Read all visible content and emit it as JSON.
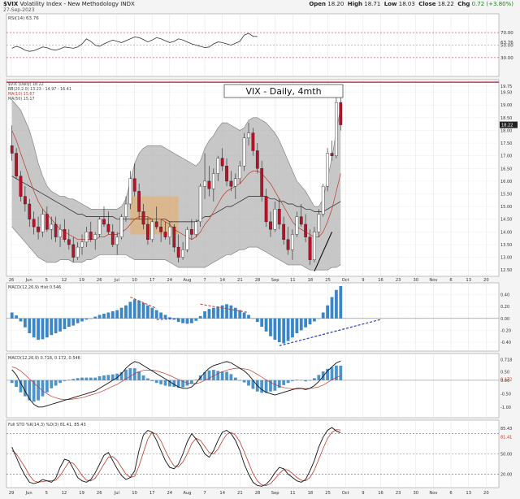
{
  "header": {
    "symbol": "$VIX",
    "name": "Volatility Index - New Methodology INDX",
    "date": "27-Sep-2023",
    "open_label": "Open",
    "open": "18.20",
    "high_label": "High",
    "high": "18.71",
    "low_label": "Low",
    "low": "18.03",
    "close_label": "Close",
    "close": "18.22",
    "chg_label": "Chg",
    "chg": "0.72 (+3.80%)"
  },
  "annotation": {
    "title": "VIX - Daily, 4mth"
  },
  "colors": {
    "up": "#ffffff",
    "down": "#b8122a",
    "band_fill": "#b4b4b4",
    "hist": "#3a87c7",
    "price_line": "#b8122a"
  },
  "chart_data": [
    {
      "panel": "rsi",
      "type": "line",
      "legend": "RSI(14) 63.76",
      "values": [
        45,
        48,
        46,
        42,
        40,
        41,
        44,
        47,
        46,
        43,
        42,
        44,
        47,
        46,
        45,
        47,
        52,
        60,
        56,
        50,
        48,
        52,
        55,
        58,
        56,
        54,
        57,
        60,
        63,
        62,
        59,
        55,
        58,
        62,
        60,
        57,
        54,
        56,
        60,
        58,
        55,
        52,
        50,
        48,
        46,
        47,
        52,
        55,
        54,
        52,
        50,
        53,
        56,
        66,
        69,
        64,
        63.8
      ],
      "ylim": [
        0,
        100
      ],
      "guides": [
        30,
        50,
        70
      ],
      "tick_labels": [
        "70.00",
        "63.76",
        "50.00",
        "30.00"
      ]
    },
    {
      "panel": "price",
      "type": "candlestick",
      "legend": [
        "$VIX (Daily) 18.22",
        "BB(20,2.0) 13.23 - 14.97 - 16.41",
        "MA(10) 15.67",
        "MA(50) 15.17"
      ],
      "x_labels": [
        "26",
        "Jun",
        "5",
        "12",
        "19",
        "26",
        "Jul",
        "10",
        "17",
        "24",
        "Aug",
        "7",
        "14",
        "21",
        "28",
        "Sep",
        "11",
        "18",
        "25",
        "Oct",
        "9",
        "16",
        "23",
        "30",
        "Nov",
        "6",
        "13",
        "20"
      ],
      "ylim": [
        12.25,
        20.0
      ],
      "y_ticks": [
        12.5,
        13.0,
        13.5,
        14.0,
        14.5,
        15.0,
        15.5,
        16.0,
        16.5,
        17.0,
        17.5,
        18.0,
        18.5,
        19.0,
        19.5,
        19.75
      ],
      "close_label": "18.22",
      "ohlc": [
        [
          17.4,
          18.2,
          16.8,
          17.1
        ],
        [
          17.1,
          17.3,
          16.1,
          16.2
        ],
        [
          16.2,
          16.4,
          15.2,
          15.4
        ],
        [
          15.4,
          15.8,
          14.8,
          15.1
        ],
        [
          15.1,
          15.3,
          14.2,
          14.5
        ],
        [
          14.5,
          14.8,
          13.9,
          14.2
        ],
        [
          14.2,
          14.6,
          13.7,
          14.0
        ],
        [
          14.0,
          14.9,
          13.8,
          14.7
        ],
        [
          14.7,
          15.0,
          14.0,
          14.1
        ],
        [
          14.1,
          14.6,
          13.7,
          14.3
        ],
        [
          14.3,
          14.6,
          13.6,
          13.8
        ],
        [
          13.8,
          14.3,
          13.4,
          14.1
        ],
        [
          14.1,
          14.5,
          13.6,
          13.7
        ],
        [
          13.7,
          14.1,
          13.3,
          13.5
        ],
        [
          13.5,
          13.8,
          12.8,
          13.0
        ],
        [
          13.0,
          13.6,
          12.9,
          13.4
        ],
        [
          13.4,
          13.9,
          13.1,
          13.6
        ],
        [
          13.6,
          14.2,
          13.4,
          14.0
        ],
        [
          14.0,
          14.4,
          13.6,
          13.7
        ],
        [
          13.7,
          14.0,
          13.3,
          13.9
        ],
        [
          13.9,
          14.6,
          13.8,
          14.5
        ],
        [
          14.5,
          15.0,
          14.2,
          14.3
        ],
        [
          14.3,
          14.8,
          13.9,
          14.0
        ],
        [
          14.0,
          14.3,
          13.4,
          13.5
        ],
        [
          13.5,
          14.0,
          13.1,
          13.8
        ],
        [
          13.8,
          14.7,
          13.7,
          14.6
        ],
        [
          14.6,
          15.4,
          14.4,
          15.1
        ],
        [
          15.1,
          16.4,
          14.9,
          16.1
        ],
        [
          16.1,
          16.7,
          15.4,
          15.6
        ],
        [
          15.6,
          15.9,
          14.5,
          14.8
        ],
        [
          14.8,
          15.1,
          14.1,
          14.3
        ],
        [
          14.3,
          14.6,
          13.5,
          13.7
        ],
        [
          13.7,
          14.5,
          13.6,
          14.4
        ],
        [
          14.4,
          15.0,
          14.1,
          14.2
        ],
        [
          14.2,
          14.5,
          13.6,
          14.0
        ],
        [
          14.0,
          14.4,
          13.7,
          13.8
        ],
        [
          13.8,
          14.4,
          13.5,
          14.2
        ],
        [
          14.2,
          14.3,
          13.2,
          13.4
        ],
        [
          13.4,
          13.9,
          12.8,
          13.0
        ],
        [
          13.0,
          13.6,
          12.9,
          13.3
        ],
        [
          13.3,
          14.2,
          13.2,
          14.1
        ],
        [
          14.1,
          14.5,
          13.7,
          13.9
        ],
        [
          13.9,
          14.5,
          13.8,
          14.4
        ],
        [
          14.4,
          15.9,
          14.2,
          15.8
        ],
        [
          15.8,
          17.1,
          15.3,
          16.0
        ],
        [
          16.0,
          16.6,
          15.4,
          15.7
        ],
        [
          15.7,
          16.5,
          15.2,
          16.3
        ],
        [
          16.3,
          17.0,
          16.0,
          16.9
        ],
        [
          16.9,
          17.3,
          16.4,
          16.6
        ],
        [
          16.6,
          16.9,
          15.8,
          16.0
        ],
        [
          16.0,
          16.4,
          15.6,
          15.8
        ],
        [
          15.8,
          16.3,
          15.3,
          16.1
        ],
        [
          16.1,
          16.8,
          15.9,
          16.6
        ],
        [
          16.6,
          17.9,
          16.4,
          17.7
        ],
        [
          17.7,
          18.3,
          17.4,
          17.9
        ],
        [
          17.9,
          18.1,
          17.0,
          17.2
        ],
        [
          17.2,
          17.5,
          16.3,
          16.5
        ],
        [
          16.5,
          16.8,
          15.2,
          15.4
        ],
        [
          15.4,
          15.7,
          14.2,
          14.4
        ],
        [
          14.4,
          14.8,
          13.8,
          14.1
        ],
        [
          14.1,
          15.2,
          14.0,
          14.9
        ],
        [
          14.9,
          15.3,
          14.1,
          14.3
        ],
        [
          14.3,
          14.6,
          13.5,
          13.7
        ],
        [
          13.7,
          14.2,
          13.1,
          13.3
        ],
        [
          13.3,
          14.1,
          12.9,
          13.9
        ],
        [
          13.9,
          14.8,
          13.8,
          14.6
        ],
        [
          14.6,
          15.1,
          14.2,
          14.3
        ],
        [
          14.3,
          14.7,
          13.6,
          13.8
        ],
        [
          13.8,
          14.1,
          12.7,
          12.9
        ],
        [
          12.9,
          14.2,
          12.8,
          14.0
        ],
        [
          14.0,
          14.9,
          13.8,
          14.7
        ],
        [
          14.7,
          15.9,
          14.6,
          15.8
        ],
        [
          15.8,
          17.3,
          15.6,
          17.1
        ],
        [
          17.1,
          17.6,
          16.8,
          17.0
        ],
        [
          17.0,
          19.4,
          16.9,
          19.1
        ],
        [
          19.1,
          19.6,
          18.0,
          18.22
        ]
      ],
      "bb_upper": [
        19.2,
        19.0,
        18.8,
        18.4,
        18.0,
        17.4,
        16.7,
        16.2,
        15.8,
        15.6,
        15.5,
        15.4,
        15.4,
        15.3,
        15.3,
        15.2,
        15.1,
        15.0,
        14.9,
        14.9,
        14.9,
        14.9,
        14.9,
        14.9,
        14.9,
        15.0,
        15.3,
        16.0,
        16.7,
        17.1,
        17.3,
        17.4,
        17.4,
        17.4,
        17.4,
        17.3,
        17.2,
        17.1,
        17.0,
        16.9,
        16.8,
        16.7,
        16.6,
        16.8,
        17.3,
        17.6,
        17.8,
        18.1,
        18.3,
        18.3,
        18.2,
        18.1,
        18.0,
        18.1,
        18.4,
        18.5,
        18.5,
        18.4,
        18.3,
        18.1,
        17.9,
        17.6,
        17.2,
        16.8,
        16.4,
        16.0,
        15.8,
        15.6,
        15.3,
        15.0,
        15.0,
        15.3,
        16.1,
        16.9,
        18.0,
        18.9
      ],
      "bb_lower": [
        14.2,
        14.0,
        13.8,
        13.6,
        13.4,
        13.2,
        13.0,
        12.9,
        12.8,
        12.8,
        12.8,
        12.9,
        12.9,
        12.9,
        12.8,
        12.8,
        12.8,
        12.9,
        12.9,
        13.0,
        13.1,
        13.1,
        13.1,
        13.1,
        13.1,
        13.1,
        13.1,
        13.0,
        12.9,
        12.9,
        12.9,
        12.9,
        12.9,
        12.9,
        12.9,
        12.9,
        12.8,
        12.7,
        12.6,
        12.6,
        12.6,
        12.6,
        12.6,
        12.6,
        12.6,
        12.7,
        12.8,
        12.9,
        13.0,
        13.1,
        13.1,
        13.2,
        13.3,
        13.3,
        13.4,
        13.4,
        13.4,
        13.3,
        13.2,
        13.1,
        13.0,
        12.9,
        12.8,
        12.7,
        12.7,
        12.7,
        12.7,
        12.6,
        12.5,
        12.5,
        12.5,
        12.5,
        12.5,
        12.6,
        12.6,
        12.7
      ],
      "ma10": [
        18.0,
        17.6,
        17.1,
        16.6,
        16.1,
        15.6,
        15.2,
        14.9,
        14.7,
        14.5,
        14.3,
        14.1,
        14.0,
        13.9,
        13.8,
        13.7,
        13.7,
        13.7,
        13.7,
        13.7,
        13.8,
        13.8,
        13.9,
        13.9,
        13.9,
        14.0,
        14.1,
        14.3,
        14.5,
        14.6,
        14.6,
        14.6,
        14.5,
        14.5,
        14.5,
        14.4,
        14.3,
        14.1,
        14.0,
        13.9,
        13.8,
        13.7,
        13.8,
        14.0,
        14.3,
        14.5,
        14.8,
        15.1,
        15.4,
        15.6,
        15.7,
        15.8,
        15.9,
        16.1,
        16.3,
        16.4,
        16.4,
        16.3,
        16.1,
        15.9,
        15.6,
        15.3,
        15.0,
        14.7,
        14.4,
        14.2,
        14.1,
        14.0,
        13.9,
        13.8,
        13.8,
        14.0,
        14.4,
        14.9,
        15.6,
        16.3
      ],
      "ma50": [
        16.2,
        16.1,
        16.0,
        15.9,
        15.8,
        15.7,
        15.6,
        15.5,
        15.4,
        15.3,
        15.2,
        15.1,
        15.0,
        14.9,
        14.8,
        14.7,
        14.7,
        14.6,
        14.6,
        14.6,
        14.6,
        14.6,
        14.6,
        14.6,
        14.5,
        14.5,
        14.5,
        14.5,
        14.5,
        14.5,
        14.5,
        14.5,
        14.5,
        14.5,
        14.5,
        14.5,
        14.4,
        14.4,
        14.4,
        14.4,
        14.4,
        14.4,
        14.4,
        14.5,
        14.6,
        14.6,
        14.7,
        14.8,
        14.9,
        15.0,
        15.0,
        15.1,
        15.2,
        15.3,
        15.4,
        15.4,
        15.4,
        15.4,
        15.4,
        15.3,
        15.3,
        15.2,
        15.2,
        15.1,
        15.1,
        15.0,
        15.0,
        14.9,
        14.9,
        14.8,
        14.8,
        14.8,
        14.9,
        15.0,
        15.1,
        15.2
      ]
    },
    {
      "panel": "macd_hist",
      "type": "bar",
      "legend": "MACD(12,26,9) Hist 0.546",
      "tick_labels": [
        "0.40",
        "0.20",
        "0.00",
        "-0.20",
        "-0.40"
      ],
      "ylim": [
        -0.55,
        0.6
      ],
      "values": [
        0.1,
        0.05,
        -0.05,
        -0.15,
        -0.25,
        -0.32,
        -0.36,
        -0.35,
        -0.32,
        -0.28,
        -0.25,
        -0.22,
        -0.18,
        -0.14,
        -0.12,
        -0.08,
        -0.05,
        -0.02,
        0.0,
        0.03,
        0.06,
        0.08,
        0.1,
        0.12,
        0.14,
        0.18,
        0.22,
        0.28,
        0.32,
        0.3,
        0.26,
        0.22,
        0.18,
        0.14,
        0.1,
        0.06,
        0.02,
        -0.02,
        -0.06,
        -0.08,
        -0.09,
        -0.08,
        -0.04,
        0.04,
        0.12,
        0.16,
        0.18,
        0.2,
        0.22,
        0.24,
        0.22,
        0.18,
        0.14,
        0.1,
        0.06,
        0.0,
        -0.06,
        -0.14,
        -0.22,
        -0.3,
        -0.36,
        -0.4,
        -0.42,
        -0.38,
        -0.32,
        -0.25,
        -0.2,
        -0.15,
        -0.1,
        -0.05,
        0.0,
        0.1,
        0.22,
        0.36,
        0.48,
        0.546
      ]
    },
    {
      "panel": "macd",
      "type": "line",
      "legend": "MACD(12,26,9) 0.718, 0.172, 0.546",
      "tick_labels": [
        "0.718",
        "0.172",
        "0.50",
        "0.00",
        "-0.50",
        "-1.00"
      ],
      "ylim": [
        -1.4,
        1.0
      ],
      "macd": [
        0.4,
        0.2,
        -0.1,
        -0.4,
        -0.7,
        -0.9,
        -1.0,
        -1.0,
        -0.95,
        -0.9,
        -0.85,
        -0.8,
        -0.75,
        -0.7,
        -0.65,
        -0.6,
        -0.55,
        -0.5,
        -0.45,
        -0.4,
        -0.3,
        -0.2,
        -0.1,
        0.0,
        0.1,
        0.25,
        0.45,
        0.6,
        0.7,
        0.65,
        0.55,
        0.45,
        0.35,
        0.25,
        0.15,
        0.05,
        -0.05,
        -0.15,
        -0.25,
        -0.3,
        -0.3,
        -0.25,
        -0.1,
        0.1,
        0.3,
        0.45,
        0.55,
        0.6,
        0.65,
        0.7,
        0.65,
        0.55,
        0.45,
        0.35,
        0.2,
        0.0,
        -0.2,
        -0.35,
        -0.45,
        -0.5,
        -0.55,
        -0.5,
        -0.45,
        -0.4,
        -0.35,
        -0.3,
        -0.3,
        -0.35,
        -0.3,
        -0.2,
        -0.05,
        0.15,
        0.35,
        0.5,
        0.65,
        0.718
      ],
      "signal": [
        0.5,
        0.45,
        0.35,
        0.2,
        0.05,
        -0.1,
        -0.25,
        -0.4,
        -0.5,
        -0.6,
        -0.65,
        -0.7,
        -0.72,
        -0.72,
        -0.7,
        -0.68,
        -0.65,
        -0.6,
        -0.55,
        -0.5,
        -0.45,
        -0.38,
        -0.3,
        -0.22,
        -0.15,
        -0.05,
        0.05,
        0.15,
        0.25,
        0.32,
        0.37,
        0.38,
        0.38,
        0.35,
        0.3,
        0.25,
        0.18,
        0.1,
        0.03,
        -0.04,
        -0.1,
        -0.12,
        -0.12,
        -0.08,
        0.0,
        0.08,
        0.16,
        0.25,
        0.32,
        0.38,
        0.42,
        0.45,
        0.45,
        0.43,
        0.4,
        0.32,
        0.22,
        0.12,
        0.02,
        -0.08,
        -0.16,
        -0.22,
        -0.27,
        -0.3,
        -0.32,
        -0.32,
        -0.31,
        -0.31,
        -0.3,
        -0.28,
        -0.25,
        -0.18,
        -0.08,
        0.02,
        0.1,
        0.172
      ]
    },
    {
      "panel": "stochastic",
      "type": "line",
      "legend": "Full STO %K(14,3) %D(3) 81.41, 85.43",
      "tick_labels": [
        "85.43",
        "81.41",
        "50.00",
        "20.00"
      ],
      "ylim": [
        0,
        100
      ],
      "guides": [
        20,
        50,
        80
      ],
      "x_labels": [
        "29",
        "Jun",
        "5",
        "12",
        "19",
        "26",
        "Jul",
        "10",
        "17",
        "24",
        "Aug",
        "7",
        "14",
        "21",
        "28",
        "Sep",
        "11",
        "18",
        "25",
        "Oct",
        "9",
        "16",
        "23",
        "30",
        "Nov",
        "6",
        "13",
        "20"
      ],
      "k": [
        60,
        45,
        30,
        18,
        8,
        6,
        8,
        12,
        10,
        8,
        14,
        30,
        42,
        40,
        28,
        15,
        10,
        8,
        12,
        22,
        35,
        48,
        52,
        40,
        28,
        18,
        12,
        15,
        25,
        55,
        78,
        85,
        82,
        70,
        55,
        40,
        30,
        28,
        35,
        50,
        68,
        80,
        72,
        62,
        50,
        45,
        55,
        70,
        82,
        85,
        80,
        70,
        55,
        35,
        20,
        8,
        3,
        2,
        5,
        12,
        22,
        30,
        28,
        20,
        15,
        10,
        8,
        12,
        25,
        40,
        60,
        75,
        85,
        89,
        84,
        81.41
      ],
      "d": [
        55,
        50,
        40,
        30,
        18,
        10,
        8,
        9,
        10,
        10,
        11,
        18,
        28,
        38,
        36,
        28,
        18,
        11,
        10,
        14,
        24,
        35,
        45,
        46,
        40,
        30,
        20,
        15,
        17,
        32,
        52,
        72,
        82,
        79,
        69,
        55,
        42,
        32,
        31,
        38,
        50,
        65,
        73,
        70,
        61,
        52,
        50,
        57,
        69,
        79,
        82,
        78,
        68,
        53,
        37,
        21,
        10,
        4,
        3,
        6,
        13,
        21,
        27,
        26,
        21,
        15,
        11,
        10,
        15,
        26,
        42,
        58,
        73,
        82,
        86,
        85.43
      ]
    }
  ]
}
